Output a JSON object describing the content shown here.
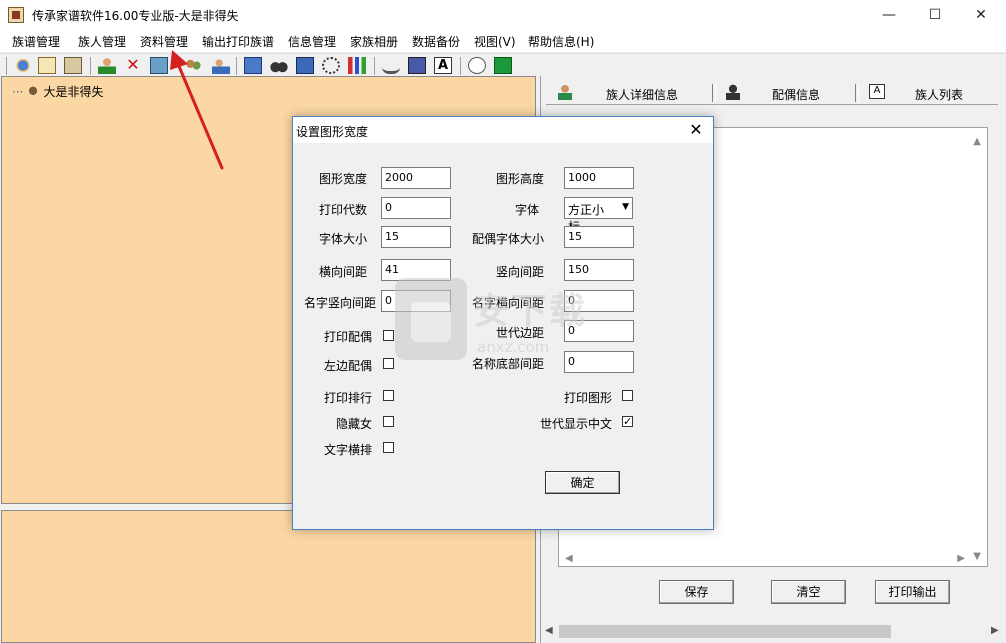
{
  "window": {
    "title": "传承家谱软件16.00专业版-大是非得失",
    "minimize": "—",
    "maximize": "☐",
    "close": "✕"
  },
  "menu": {
    "items": [
      "族谱管理",
      "族人管理",
      "资料管理",
      "输出打印族谱",
      "信息管理",
      "家族相册",
      "数据备份",
      "视图(V)",
      "帮助信息(H)"
    ]
  },
  "tree": {
    "root": "大是非得失"
  },
  "tabs": {
    "items": [
      "族人详细信息",
      "配偶信息",
      "族人列表"
    ]
  },
  "right_buttons": {
    "save": "保存",
    "clear": "清空",
    "print": "打印输出"
  },
  "dialog": {
    "title": "设置图形宽度",
    "close": "✕",
    "fields": {
      "width_label": "图形宽度",
      "width_value": "2000",
      "height_label": "图形高度",
      "height_value": "1000",
      "gen_label": "打印代数",
      "gen_value": "0",
      "font_label": "字体",
      "font_value": "方正小标",
      "fontsize_label": "字体大小",
      "fontsize_value": "15",
      "spouse_fontsize_label": "配偶字体大小",
      "spouse_fontsize_value": "15",
      "hgap_label": "横向间距",
      "hgap_value": "41",
      "vgap_label": "竖向间距",
      "vgap_value": "150",
      "name_vgap_label": "名字竖向间距",
      "name_vgap_value": "0",
      "name_hgap_label": "名字横向间距",
      "name_hgap_value": "0",
      "gen_margin_label": "世代边距",
      "gen_margin_value": "0",
      "name_bottom_label": "名称底部间距",
      "name_bottom_value": "0"
    },
    "checks": {
      "print_spouse": "打印配偶",
      "left_spouse": "左边配偶",
      "print_rank": "打印排行",
      "print_graph": "打印图形",
      "hide_female": "隐藏女",
      "gen_chinese": "世代显示中文",
      "gen_chinese_mark": "✓",
      "text_horizontal": "文字横排"
    },
    "ok": "确定"
  },
  "watermark": {
    "text": "安下载",
    "sub": "anxz.com"
  },
  "colors": {
    "pane_bg": "#fad7a3",
    "arrow": "#d42020"
  }
}
